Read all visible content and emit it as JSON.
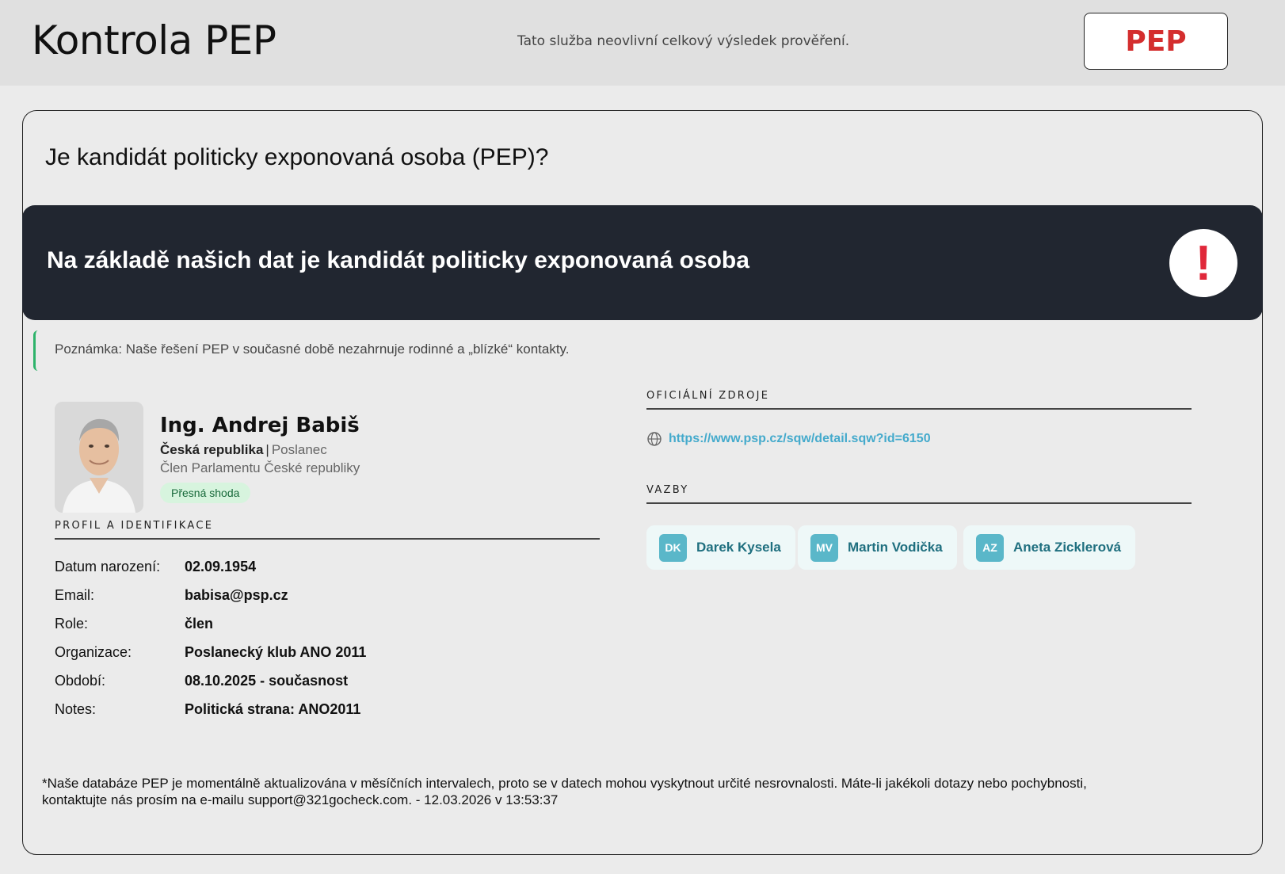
{
  "header": {
    "title": "Kontrola PEP",
    "subtitle": "Tato služba neovlivní celkový výsledek prověření.",
    "badge": "PEP"
  },
  "card": {
    "question": "Je kandidát politicky exponovaná osoba (PEP)?",
    "alert_text": "Na základě našich dat je kandidát politicky exponovaná osoba",
    "alert_icon": "!",
    "note": "Poznámka: Naše řešení PEP v současné době nezahrnuje rodinné a „blízké“ kontakty."
  },
  "person": {
    "name": "Ing. Andrej Babiš",
    "country": "Česká republika",
    "separator": "|",
    "position": "Poslanec",
    "organization": "Člen Parlamentu České republiky",
    "match": "Přesná shoda"
  },
  "profile": {
    "title": "PROFIL A IDENTIFIKACE",
    "rows": [
      {
        "label": "Datum narození:",
        "value": "02.09.1954"
      },
      {
        "label": "Email:",
        "value": "babisa@psp.cz"
      },
      {
        "label": "Role:",
        "value": "člen"
      },
      {
        "label": "Organizace:",
        "value": "Poslanecký klub ANO 2011"
      },
      {
        "label": "Období:",
        "value": "08.10.2025 - současnost"
      },
      {
        "label": "Notes:",
        "value": "Politická strana: ANO2011"
      }
    ]
  },
  "sources": {
    "title": "OFICIÁLNÍ ZDROJE",
    "link": "https://www.psp.cz/sqw/detail.sqw?id=6150"
  },
  "relations": {
    "title": "VAZBY",
    "items": [
      {
        "initials": "DK",
        "name": "Darek Kysela"
      },
      {
        "initials": "MV",
        "name": "Martin Vodička"
      },
      {
        "initials": "AZ",
        "name": "Aneta Zicklerová"
      }
    ]
  },
  "footer": {
    "line1": "*Naše databáze PEP je momentálně aktualizována v měsíčních intervalech, proto se v datech mohou vyskytnout určité nesrovnalosti. Máte-li jakékoli dotazy nebo pochybnosti,",
    "line2": "kontaktujte nás prosím na e-mailu support@321gocheck.com. - 12.03.2026 v 13:53:37"
  },
  "colors": {
    "alert_bg": "#212630",
    "alert_icon": "#e0283a",
    "badge_text": "#d42e2e",
    "link": "#44aacc",
    "match_bg": "#d7f4de",
    "avatar": "#5ab7c9"
  },
  "icons": {
    "alert": "exclamation-icon",
    "source": "globe-icon"
  }
}
